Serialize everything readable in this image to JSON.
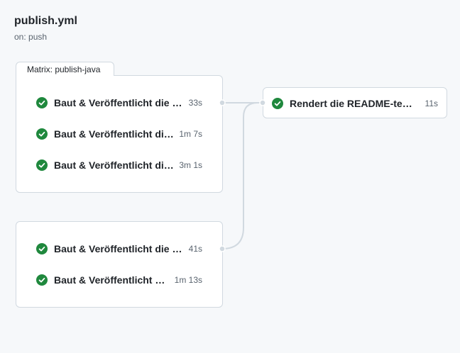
{
  "workflow": {
    "title": "publish.yml",
    "trigger": "on: push"
  },
  "matrix": {
    "label": "Matrix: publish-java",
    "jobs": [
      {
        "name": "Baut & Veröffentlicht die Ja...",
        "duration": "33s",
        "status": "success"
      },
      {
        "name": "Baut & Veröffentlicht die ...",
        "duration": "1m 7s",
        "status": "success"
      },
      {
        "name": "Baut & Veröffentlicht die ...",
        "duration": "3m 1s",
        "status": "success"
      }
    ]
  },
  "group2": {
    "jobs": [
      {
        "name": "Baut & Veröffentlicht die Se...",
        "duration": "41s",
        "status": "success"
      },
      {
        "name": "Baut & Veröffentlicht da...",
        "duration": "1m 13s",
        "status": "success"
      }
    ]
  },
  "downstream": {
    "jobs": [
      {
        "name": "Rendert die README-templ...",
        "duration": "11s",
        "status": "success"
      }
    ]
  },
  "colors": {
    "success": "#1f883d",
    "connector": "#d1d9e0",
    "background": "#f6f8fa"
  },
  "icons": {
    "status_success": "check-circle-fill-icon"
  }
}
